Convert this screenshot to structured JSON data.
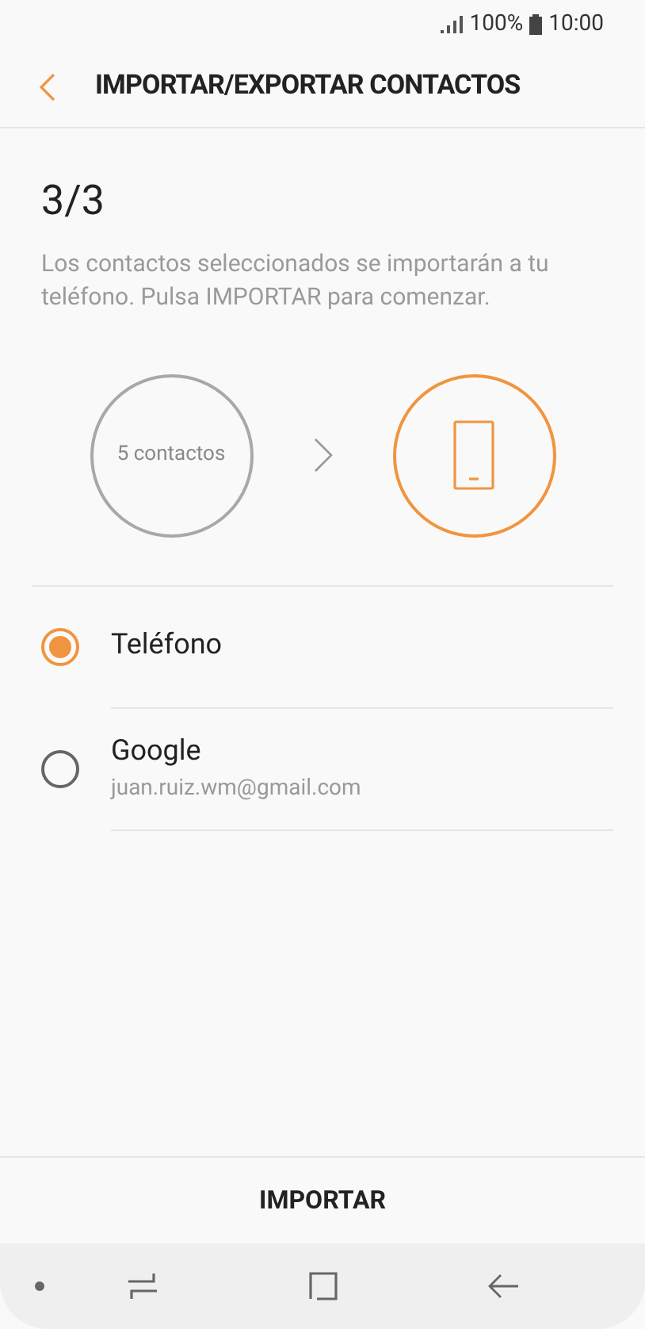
{
  "status_bar": {
    "battery": "100%",
    "time": "10:00"
  },
  "header": {
    "title": "IMPORTAR/EXPORTAR CONTACTOS"
  },
  "step": "3/3",
  "description": "Los contactos seleccionados se importarán a tu teléfono. Pulsa IMPORTAR para comenzar.",
  "source": {
    "label": "5 contactos"
  },
  "options": [
    {
      "label": "Teléfono",
      "selected": true
    },
    {
      "label": "Google",
      "subtitle": "juan.ruiz.wm@gmail.com",
      "selected": false
    }
  ],
  "action_button": "IMPORTAR"
}
